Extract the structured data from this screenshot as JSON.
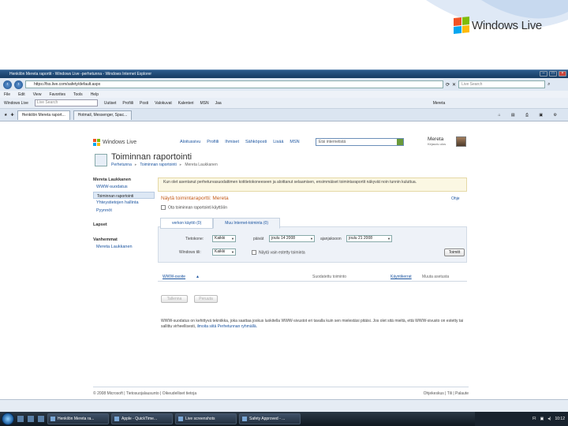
{
  "slide": {
    "logo_text": "Windows Live"
  },
  "browser": {
    "title": "Henkilön Mereta raportit - Windows Live -perhetunna - Windows Internet Explorer",
    "url": "https://fss.live.com/safety/default.aspx",
    "live_search_placeholder": "Live Search",
    "menu": [
      "File",
      "Edit",
      "View",
      "Favorites",
      "Tools",
      "Help"
    ],
    "toolbar": {
      "brand": "Windows Live",
      "search_placeholder": "Live Search",
      "items": [
        "Uutiset",
        "Profiili",
        "Posti",
        "Valokuvat",
        "Kalenteri",
        "MSN",
        "Jaa"
      ],
      "user": "Mereta"
    },
    "tabs": [
      "Henkilön Mereta raport...",
      "Hotmail, Messenger, Spac..."
    ]
  },
  "page": {
    "brand": "Windows Live",
    "nav": [
      "Aloitussivu",
      "Profiili",
      "Ihmiset",
      "Sähköposti",
      "Lisää",
      "MSN"
    ],
    "search_placeholder": "Etsi internetistä",
    "user_name": "Mereta",
    "user_sub": "Kirjaudu ulos",
    "title": "Toiminnan raportointi",
    "breadcrumb": [
      "Perhetunna",
      "Toiminnan raportointi",
      "Mereta Laukkanen"
    ],
    "sidebar": {
      "heading": "Mereta Laukkanen",
      "sub_item": "WWW-suodatus",
      "items": [
        "Toiminnan raportointi",
        "Yhteystietojen hallinta",
        "Pyynnöt"
      ],
      "section_lapset": "Lapset",
      "section_vanhemmat": "Vanhemmat",
      "parent_name": "Mereta Laukkanen"
    },
    "notice": "Kun olet asentanut perheturvasuodattimen kotitietokoneeseen ja aloittanut selaamisen, ensimmäiset toimintaraportit näkyvät noin tunnin kuluttua.",
    "report_title": "Näytä toimintaraportti: Mereta",
    "help": "Ohje",
    "enable_reporting": "Ota toiminnan raportointi käyttöön",
    "report_tabs": [
      "verkon käyttö (0)",
      "Muu Internet-toiminta (0)"
    ],
    "filter": {
      "computer_label": "Tietokone:",
      "computer_value": "Kaikki",
      "from_label": "päivät",
      "from_value": "joulu 14 2008",
      "to_label": "ajanjaksoon",
      "to_value": "joulu 21 2008",
      "account_label": "Windows tili:",
      "account_value": "Kaikki",
      "blocked_only": "Näytä vain estetty toiminta",
      "apply_button": "Toimitt"
    },
    "columns": {
      "url": "WWW-osoite",
      "filtered": "Suodatettu toiminto",
      "visits": "Käyntikerrat",
      "change": "Muuta asetusta"
    },
    "buttons": {
      "save": "Tallenna",
      "cancel": "Peruuta"
    },
    "footer_note_1": "WWW-suodatus on kehittyvä tekniikka, joka saattaa joskus luokitella WWW-sivustot eri tavalla kuin sen mielestäsi pitäisi. Jos olet sitä mieltä, että WWW-sivusto on estetty tai sallittu virheellisesti,",
    "footer_note_link": "ilmoita siitä Perhetunnan ryhmällä.",
    "footer": {
      "copyright": "© 2008 Microsoft",
      "links": [
        "Tietosuojalausunto",
        "Oikeudelliset tietoja"
      ],
      "right_links": [
        "Ohjekeskus",
        "Tili",
        "Palaute"
      ]
    }
  },
  "taskbar": {
    "buttons": [
      "Henkilön Mereta ra...",
      "Apple - QuickTime...",
      "Live screenshots",
      "Safety Approved - ..."
    ],
    "lang": "FI",
    "time": "10:12"
  },
  "colors": {
    "link": "#1c55a0",
    "report_title": "#c45c1a",
    "windows_flag": [
      "#f35325",
      "#81bc06",
      "#05a6f0",
      "#ffba08"
    ]
  }
}
